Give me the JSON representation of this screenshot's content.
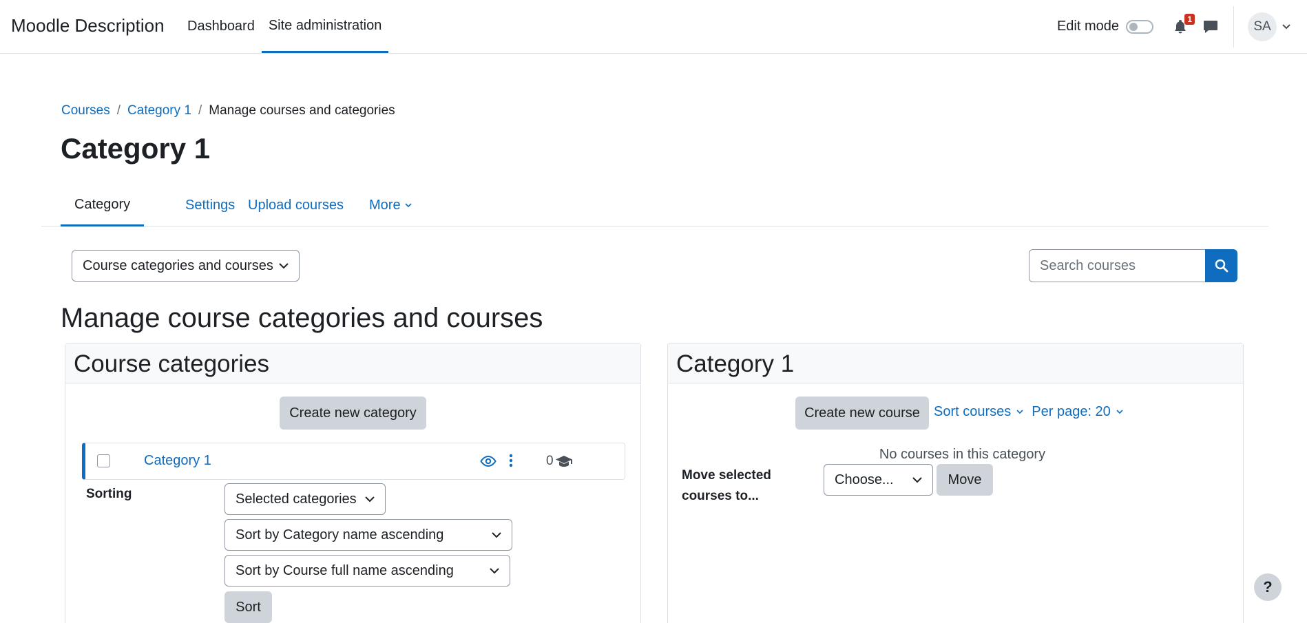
{
  "navbar": {
    "brand": "Moodle Description",
    "items": [
      {
        "label": "Dashboard",
        "active": false
      },
      {
        "label": "Site administration",
        "active": true
      }
    ],
    "edit_mode_label": "Edit mode",
    "notification_count": "1",
    "user_initials": "SA"
  },
  "breadcrumb": {
    "items": [
      "Courses",
      "Category 1",
      "Manage courses and categories"
    ],
    "separator": "/"
  },
  "page_title": "Category 1",
  "secondary_nav": {
    "tabs": [
      "Category",
      "Settings",
      "Upload courses",
      "More"
    ]
  },
  "view_select": {
    "value": "Course categories and courses"
  },
  "search": {
    "placeholder": "Search courses"
  },
  "heading": "Manage course categories and courses",
  "categories_panel": {
    "title": "Course categories",
    "create_button": "Create new category",
    "rows": [
      {
        "name": "Category 1",
        "course_count": "0"
      }
    ],
    "sorting_label": "Sorting",
    "sort_scope": "Selected categories",
    "sort_categories": "Sort by Category name ascending",
    "sort_courses": "Sort by Course full name ascending",
    "sort_button": "Sort"
  },
  "courses_panel": {
    "title": "Category 1",
    "create_button": "Create new course",
    "sort_link": "Sort courses",
    "per_page_link": "Per page: 20",
    "empty_message": "No courses in this category",
    "move_label_line1": "Move selected",
    "move_label_line2": "courses to...",
    "move_select": "Choose...",
    "move_button": "Move"
  },
  "help_label": "?",
  "colors": {
    "primary": "#0f6cbf",
    "secondary_btn": "#ced4da",
    "badge": "#ca3120"
  }
}
